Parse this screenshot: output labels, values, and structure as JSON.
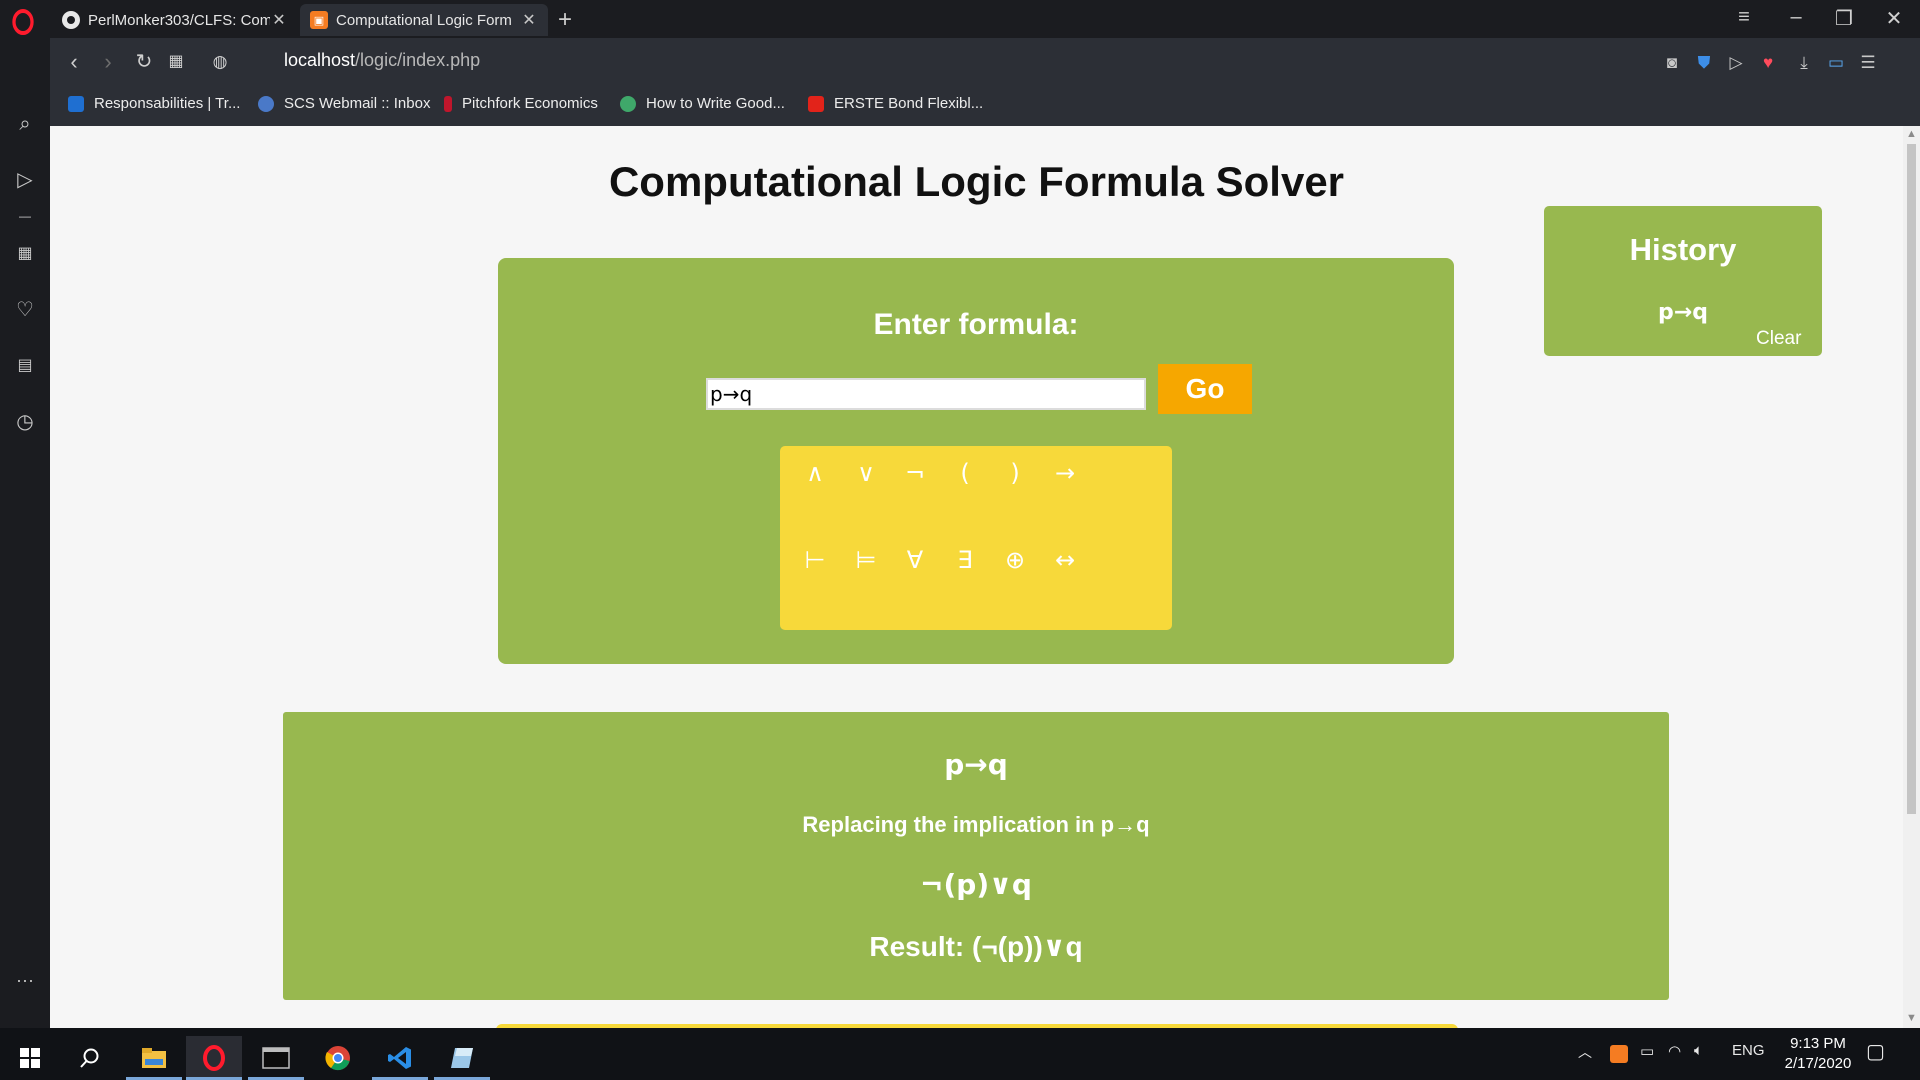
{
  "browser": {
    "tabs": [
      {
        "title": "PerlMonker303/CLFS: Comp",
        "close": "✕"
      },
      {
        "title": "Computational Logic Form",
        "close": "✕"
      }
    ],
    "new_tab": "+",
    "url_host": "localhost",
    "url_path": "/logic/index.php",
    "bookmarks": [
      {
        "label": "Responsabilities | Tr...",
        "color": "#1f6fd1"
      },
      {
        "label": "SCS Webmail :: Inbox",
        "color": "#4a79c8"
      },
      {
        "label": "Pitchfork Economics",
        "color": "#c0162c"
      },
      {
        "label": "How to Write Good...",
        "color": "#3fa86a"
      },
      {
        "label": "ERSTE Bond Flexibl...",
        "color": "#e2231a"
      }
    ]
  },
  "page": {
    "title": "Computational Logic Formula Solver",
    "enter_label": "Enter formula:",
    "formula_value": "p→q",
    "go_label": "Go",
    "keypad_row1": [
      "∧",
      "∨",
      "¬",
      "(",
      ")",
      "→"
    ],
    "keypad_row2": [
      "⊢",
      "⊨",
      "∀",
      "∃",
      "⊕",
      "↔"
    ],
    "history": {
      "title": "History",
      "items": [
        "p→q"
      ],
      "clear_label": "Clear"
    },
    "result": {
      "formula": "p→q",
      "step": "Replacing the implication in p→q",
      "transformed": "¬(p)∨q",
      "result": "Result: (¬(p))∨q"
    }
  },
  "taskbar": {
    "language": "ENG",
    "time": "9:13 PM",
    "date": "2/17/2020"
  },
  "colors": {
    "panel_green": "#98b84f",
    "keypad_yellow": "#f7d93a",
    "go_orange": "#f6a700"
  }
}
